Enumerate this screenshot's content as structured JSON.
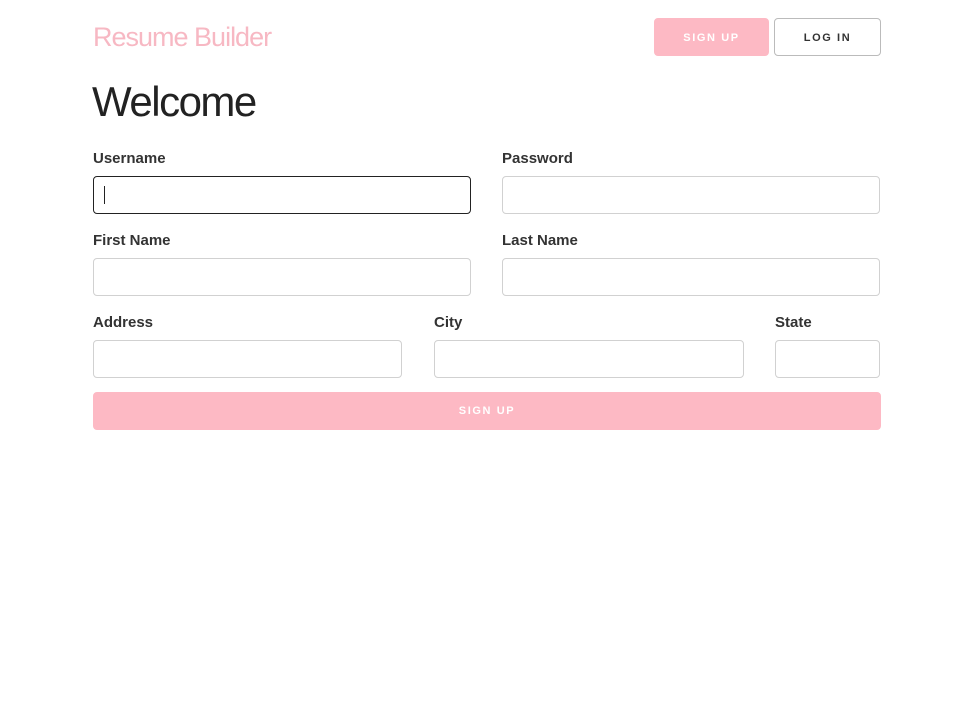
{
  "header": {
    "brand": "Resume Builder",
    "signup_label": "SIGN UP",
    "login_label": "LOG IN"
  },
  "page_title": "Welcome",
  "form": {
    "username": {
      "label": "Username",
      "value": "",
      "placeholder": ""
    },
    "password": {
      "label": "Password",
      "value": "",
      "placeholder": ""
    },
    "first_name": {
      "label": "First Name",
      "value": "",
      "placeholder": ""
    },
    "last_name": {
      "label": "Last Name",
      "value": "",
      "placeholder": ""
    },
    "address": {
      "label": "Address",
      "value": "",
      "placeholder": ""
    },
    "city": {
      "label": "City",
      "value": "",
      "placeholder": ""
    },
    "state": {
      "label": "State",
      "value": "",
      "placeholder": ""
    },
    "submit_label": "SIGN UP"
  },
  "colors": {
    "accent": "#fdb9c4",
    "brand": "#f7b8c3",
    "text": "#222222"
  }
}
